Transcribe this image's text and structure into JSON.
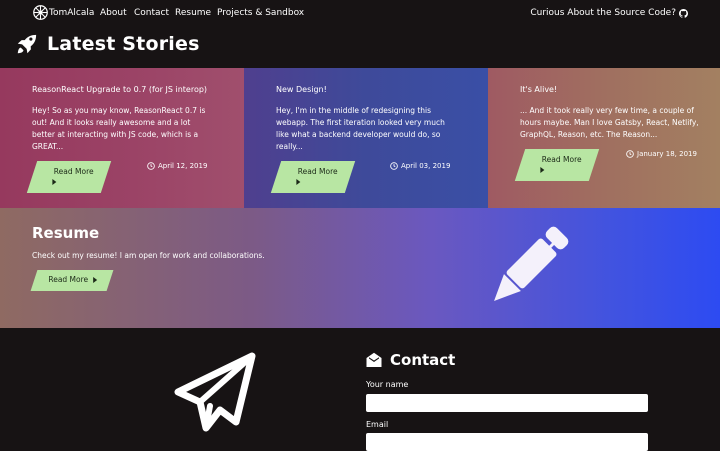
{
  "nav": {
    "brand": "TomAlcala",
    "brand_icon": "galactic-empire-icon",
    "links": [
      "About",
      "Contact",
      "Resume",
      "Projects & Sandbox"
    ],
    "source_link": "Curious About the Source Code?",
    "source_icon": "github-icon"
  },
  "stories": {
    "title": "Latest Stories",
    "icon": "rocket-icon",
    "cards": [
      {
        "title": "ReasonReact Upgrade to 0.7 (for JS interop)",
        "excerpt": "Hey! So as you may know, ReasonReact 0.7 is out! And it looks really awesome and a lot better at interacting with JS code, which is a GREAT...",
        "read_more": "Read More",
        "date": "April 12, 2019"
      },
      {
        "title": "New Design!",
        "excerpt": "Hey, I'm in the middle of redesigning this webapp. The first iteration looked very much like what a backend developer would do, so really...",
        "read_more": "Read More",
        "date": "April 03, 2019"
      },
      {
        "title": "It's Alive!",
        "excerpt": "... And it took really very few time, a couple of hours maybe. Man I love Gatsby, React, Netlify, GraphQL, Reason, etc. The Reason...",
        "read_more": "Read More",
        "date": "January 18, 2019"
      }
    ]
  },
  "resume": {
    "title": "Resume",
    "description": "Check out my resume! I am open for work and collaborations.",
    "button": "Read More",
    "icon": "pen-icon"
  },
  "contact": {
    "title": "Contact",
    "icon": "envelope-open-icon",
    "illustration": "paper-plane-icon",
    "name_label": "Your name",
    "email_label": "Email",
    "name_value": "",
    "email_value": ""
  },
  "colors": {
    "background": "#171314",
    "button": "#b8e6a3",
    "card1": "#9b4366",
    "card2": "#3e4a9a",
    "card3": "#a06f60",
    "resume_end": "#2d4bf2"
  }
}
